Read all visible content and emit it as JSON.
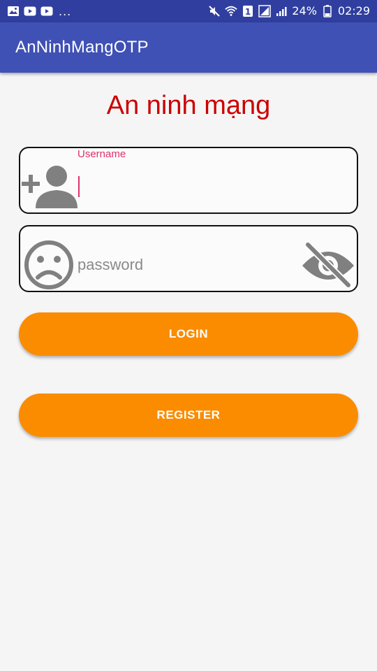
{
  "status_bar": {
    "left_icons": [
      "image-icon",
      "youtube-icon",
      "youtube-icon"
    ],
    "more": "...",
    "right_icons": [
      "mute-icon",
      "wifi-icon",
      "sim-1-icon",
      "signal-icon",
      "signal-icon"
    ],
    "battery": "24%",
    "time": "02:29"
  },
  "app_bar": {
    "title": "AnNinhMangOTP"
  },
  "page": {
    "title": "An ninh mạng"
  },
  "username": {
    "label": "Username",
    "value": "",
    "icon": "add-person-icon"
  },
  "password": {
    "placeholder": "password",
    "icon": "sad-face-icon",
    "toggle_icon": "visibility-off-icon"
  },
  "buttons": {
    "login": "LOGIN",
    "register": "REGISTER"
  },
  "colors": {
    "status_bar": "#303f9f",
    "app_bar": "#3f51b5",
    "title": "#cc0000",
    "accent": "#e0306c",
    "button": "#fb8c00",
    "icon": "#808080"
  }
}
